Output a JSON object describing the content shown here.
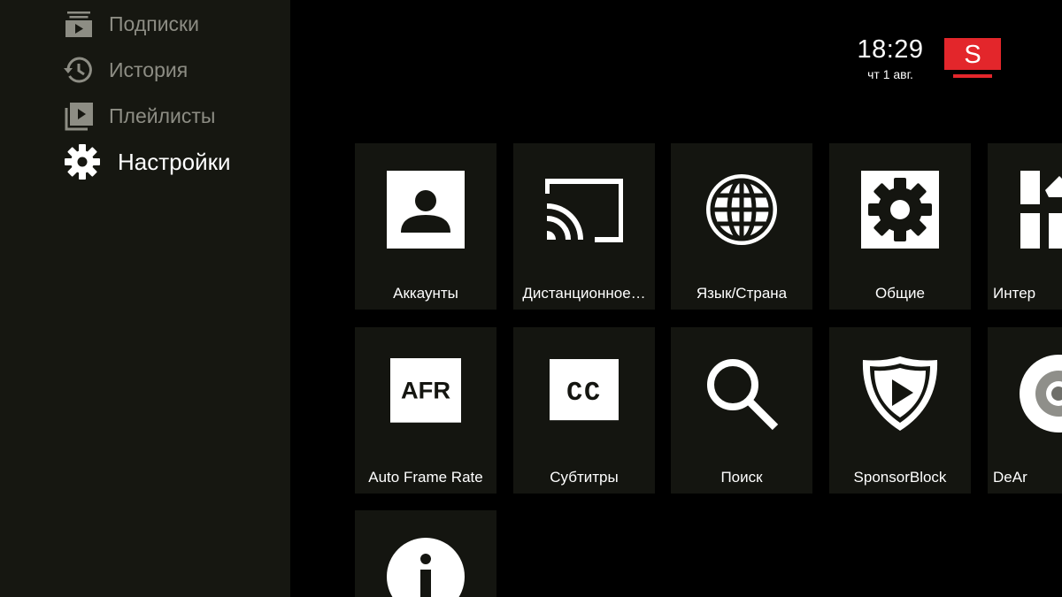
{
  "sidebar": {
    "items": [
      {
        "label": "Подписки",
        "icon": "subscriptions-icon"
      },
      {
        "label": "История",
        "icon": "history-icon"
      },
      {
        "label": "Плейлисты",
        "icon": "playlists-icon"
      },
      {
        "label": "Настройки",
        "icon": "gear-icon",
        "active": true
      }
    ]
  },
  "status": {
    "time": "18:29",
    "date": "чт 1 авг."
  },
  "logo": {
    "letter": "S",
    "color": "#e3262b"
  },
  "settings": {
    "tiles": [
      {
        "label": "Аккаунты",
        "icon": "account-icon"
      },
      {
        "label": "Дистанционное…",
        "icon": "cast-icon"
      },
      {
        "label": "Язык/Страна",
        "icon": "globe-icon"
      },
      {
        "label": "Общие",
        "icon": "gear-icon"
      },
      {
        "label": "Интер",
        "icon": "interface-icon"
      },
      {
        "label": "Auto Frame Rate",
        "icon": "afr-icon",
        "icon_text": "AFR"
      },
      {
        "label": "Субтитры",
        "icon": "cc-icon",
        "icon_text": "CC"
      },
      {
        "label": "Поиск",
        "icon": "search-icon"
      },
      {
        "label": "SponsorBlock",
        "icon": "sponsorblock-icon"
      },
      {
        "label": "DeAr",
        "icon": "dearrow-icon"
      },
      {
        "label": "",
        "icon": "info-icon"
      }
    ]
  }
}
